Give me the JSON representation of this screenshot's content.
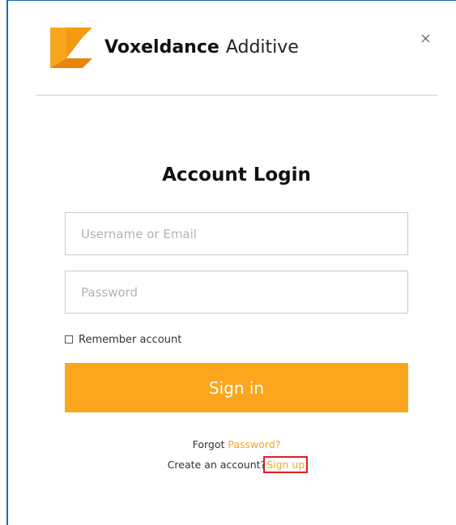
{
  "app": {
    "brand_bold": "Voxeldance",
    "brand_light": "Additive"
  },
  "colors": {
    "accent": "#fba61d",
    "link": "#f5a623",
    "highlight_box": "#e01e1e",
    "window_frame": "#1a6bb5"
  },
  "icons": {
    "logo": "voxeldance-logo-icon",
    "close": "close-icon"
  },
  "login": {
    "title": "Account Login",
    "username_placeholder": "Username or Email",
    "password_placeholder": "Password",
    "remember_label": "Remember account",
    "remember_checked": false,
    "signin_label": "Sign in",
    "forgot_prefix": "Forgot",
    "forgot_link": "Password?",
    "create_prefix": "Create an account?",
    "signup_link": "Sign up"
  }
}
